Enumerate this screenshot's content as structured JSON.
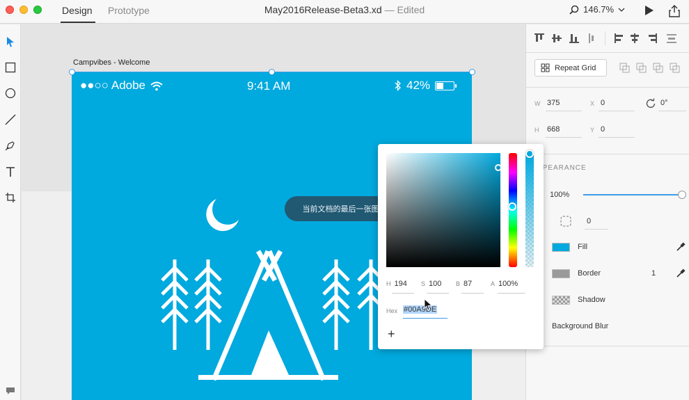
{
  "titlebar": {
    "tabs": [
      "Design",
      "Prototype"
    ],
    "doc_name": "May2016Release-Beta3.xd",
    "doc_status": "— Edited",
    "zoom": "146.7%"
  },
  "toolbar": {
    "tools": [
      "select-tool",
      "rectangle-tool",
      "ellipse-tool",
      "line-tool",
      "pen-tool",
      "text-tool",
      "artboard-tool"
    ]
  },
  "artboard": {
    "label": "Campvibes - Welcome",
    "carrier": "●●○○ Adobe",
    "time": "9:41 AM",
    "battery": "42%",
    "battery_level": 0.42,
    "background": "#00a9de"
  },
  "tooltip": {
    "text": "当前文档的最后一张图片"
  },
  "color_picker": {
    "h_label": "H",
    "h": "194",
    "s_label": "S",
    "s": "100",
    "b_label": "B",
    "b": "87",
    "a_label": "A",
    "a": "100%",
    "hex_label": "Hex",
    "hex": "#00A9DE",
    "add_label": "+"
  },
  "panel": {
    "repeat_grid": "Repeat Grid",
    "w_label": "W",
    "w": "375",
    "x_label": "X",
    "x": "0",
    "rotation": "0°",
    "h_label": "H",
    "h": "668",
    "y_label": "Y",
    "y": "0",
    "appearance": "PPEARANCE",
    "opacity": "100%",
    "radius": "0",
    "fill_label": "Fill",
    "fill_color": "#00a9de",
    "border_label": "Border",
    "border_width": "1",
    "border_color": "#9a9a9a",
    "shadow_label": "Shadow",
    "blur_label": "Background Blur"
  }
}
